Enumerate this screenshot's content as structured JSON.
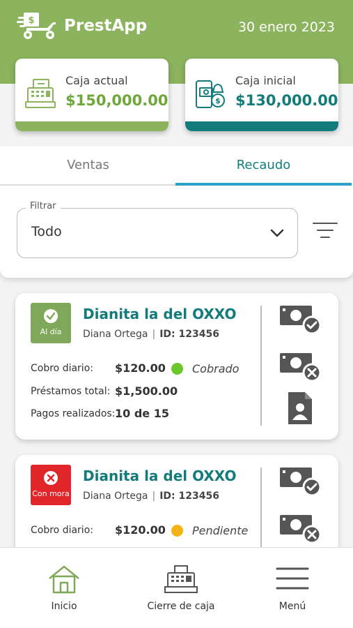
{
  "header": {
    "app_name": "PrestApp",
    "date": "30 enero 2023",
    "color": "#8cb35e"
  },
  "cajas": [
    {
      "label": "Caja actual",
      "amount": "$150,000.00",
      "icon": "cash-register-icon",
      "accent": "#8cb35e",
      "amount_color": "#6ea83a"
    },
    {
      "label": "Caja inicial",
      "amount": "$130,000.00",
      "icon": "phone-money-icon",
      "accent": "#137b7b",
      "amount_color": "#137b7b"
    }
  ],
  "tabs": [
    {
      "label": "Ventas",
      "active": false
    },
    {
      "label": "Recaudo",
      "active": true
    }
  ],
  "filter": {
    "legend": "Filtrar",
    "value": "Todo",
    "icon": "filter-lines-icon"
  },
  "loans": [
    {
      "status": "Al día",
      "status_color": "#7fa85a",
      "name": "Dianita la del OXXO",
      "client": "Diana Ortega",
      "id": "ID: 123456",
      "cobro_label": "Cobro diario:",
      "cobro_value": "$120.00",
      "cobro_state": "Cobrado",
      "cobro_dot": "#6cc72a",
      "prestamos_label": "Préstamos total:",
      "prestamos_value": "$1,500.00",
      "pagos_label": "Pagos realizados:",
      "pagos_value": "10 de 15"
    },
    {
      "status": "Con mora",
      "status_color": "#e0262b",
      "name": "Dianita la del OXXO",
      "client": "Diana Ortega",
      "id": "ID: 123456",
      "cobro_label": "Cobro diario:",
      "cobro_value": "$120.00",
      "cobro_state": "Pendiente",
      "cobro_dot": "#f3b418"
    }
  ],
  "nav": [
    {
      "label": "Inicio",
      "icon": "home-icon",
      "color": "#7fa85a"
    },
    {
      "label": "Cierre de caja",
      "icon": "cash-register-icon"
    },
    {
      "label": "Menú",
      "icon": "hamburger-menu-icon"
    }
  ]
}
